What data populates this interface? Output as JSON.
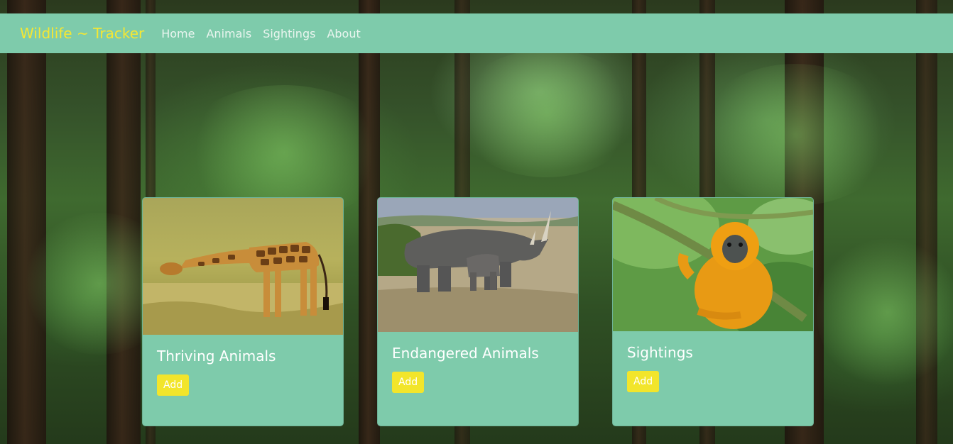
{
  "navbar": {
    "brand": "Wildlife ~ Tracker",
    "links": [
      "Home",
      "Animals",
      "Sightings",
      "About"
    ]
  },
  "cards": [
    {
      "title": "Thriving Animals",
      "button": "Add",
      "image": "giraffe"
    },
    {
      "title": "Endangered Animals",
      "button": "Add",
      "image": "rhinoceros-with-calf"
    },
    {
      "title": "Sightings",
      "button": "Add",
      "image": "golden-monkey"
    }
  ],
  "colors": {
    "navbar_bg": "#7ecbab",
    "brand": "#f5e733",
    "button_bg": "#f2e52b",
    "card_bg": "#7ecbab"
  }
}
